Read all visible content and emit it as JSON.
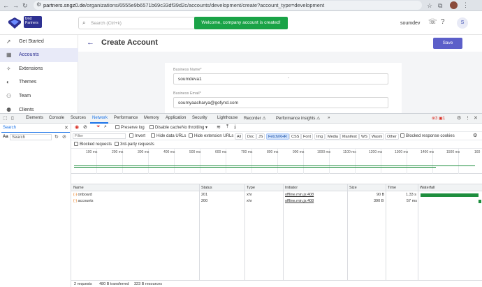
{
  "browser": {
    "url_host": "partners.sngz0.de",
    "url_path": "/organizations/6555e9b6571b69c33df39d2c/accounts/development/create?account_type=development"
  },
  "app": {
    "logo_text": "fynd Partners",
    "search_placeholder": "Search (Ctrl+k)",
    "toast": "Welcome, company account is created!",
    "username": "soumdev",
    "avatar_letter": "S",
    "sidebar": [
      {
        "label": "Get Started",
        "icon": "rocket-icon"
      },
      {
        "label": "Accounts",
        "icon": "accounts-icon",
        "active": true
      },
      {
        "label": "Extensions",
        "icon": "extensions-icon"
      },
      {
        "label": "Themes",
        "icon": "themes-icon"
      },
      {
        "label": "Team",
        "icon": "team-icon"
      },
      {
        "label": "Clients",
        "icon": "clients-icon"
      }
    ],
    "page_title": "Create Account",
    "save_label": "Save",
    "form": {
      "business_name_label": "Business Name*",
      "business_name_value": "soumdeva1",
      "business_email_label": "Business Email*",
      "business_email_value": "soumyaacharya@gofynd.com"
    }
  },
  "devtools": {
    "tabs": [
      "Elements",
      "Console",
      "Sources",
      "Network",
      "Performance",
      "Memory",
      "Application",
      "Security",
      "Lighthouse",
      "Recorder ⚠",
      "Performance insights ⚠"
    ],
    "active_tab": "Network",
    "errors": "3",
    "warnings": "1",
    "search_tab": "Search",
    "search_aa": "Aa",
    "search_placeholder": "Search",
    "toolbar": {
      "preserve_log": "Preserve log",
      "disable_cache": "Disable cache",
      "throttling": "No throttling"
    },
    "filter": {
      "placeholder": "Filter",
      "invert": "Invert",
      "hide_data_urls": "Hide data URLs",
      "hide_extension_urls": "Hide extension URLs",
      "types": [
        "All",
        "Doc",
        "JS",
        "Fetch/XHR",
        "CSS",
        "Font",
        "Img",
        "Media",
        "Manifest",
        "WS",
        "Wasm",
        "Other"
      ],
      "active_type": "Fetch/XHR",
      "blocked_response_cookies": "Blocked response cookies",
      "blocked_requests": "Blocked requests",
      "third_party": "3rd-party requests"
    },
    "timeline_ticks": [
      "100 ms",
      "200 ms",
      "300 ms",
      "400 ms",
      "500 ms",
      "600 ms",
      "700 ms",
      "800 ms",
      "900 ms",
      "1000 ms",
      "1100 ms",
      "1200 ms",
      "1300 ms",
      "1400 ms",
      "1500 ms",
      "160"
    ],
    "columns": [
      "Name",
      "Status",
      "Type",
      "Initiator",
      "Size",
      "Time",
      "Waterfall"
    ],
    "rows": [
      {
        "name": "onboard",
        "status": "201",
        "type": "xhr",
        "initiator": "offline.min.js:408",
        "size": "90 B",
        "time": "1.33 s",
        "wf_start": 0.0,
        "wf_fraction": 0.97
      },
      {
        "name": "accounts",
        "status": "200",
        "type": "xhr",
        "initiator": "offline.min.js:408",
        "size": "390 B",
        "time": "57 ms",
        "wf_start": 0.97,
        "wf_fraction": 0.04
      }
    ],
    "status": {
      "requests": "2 requests",
      "transferred": "480 B transferred",
      "resources": "323 B resources"
    }
  }
}
